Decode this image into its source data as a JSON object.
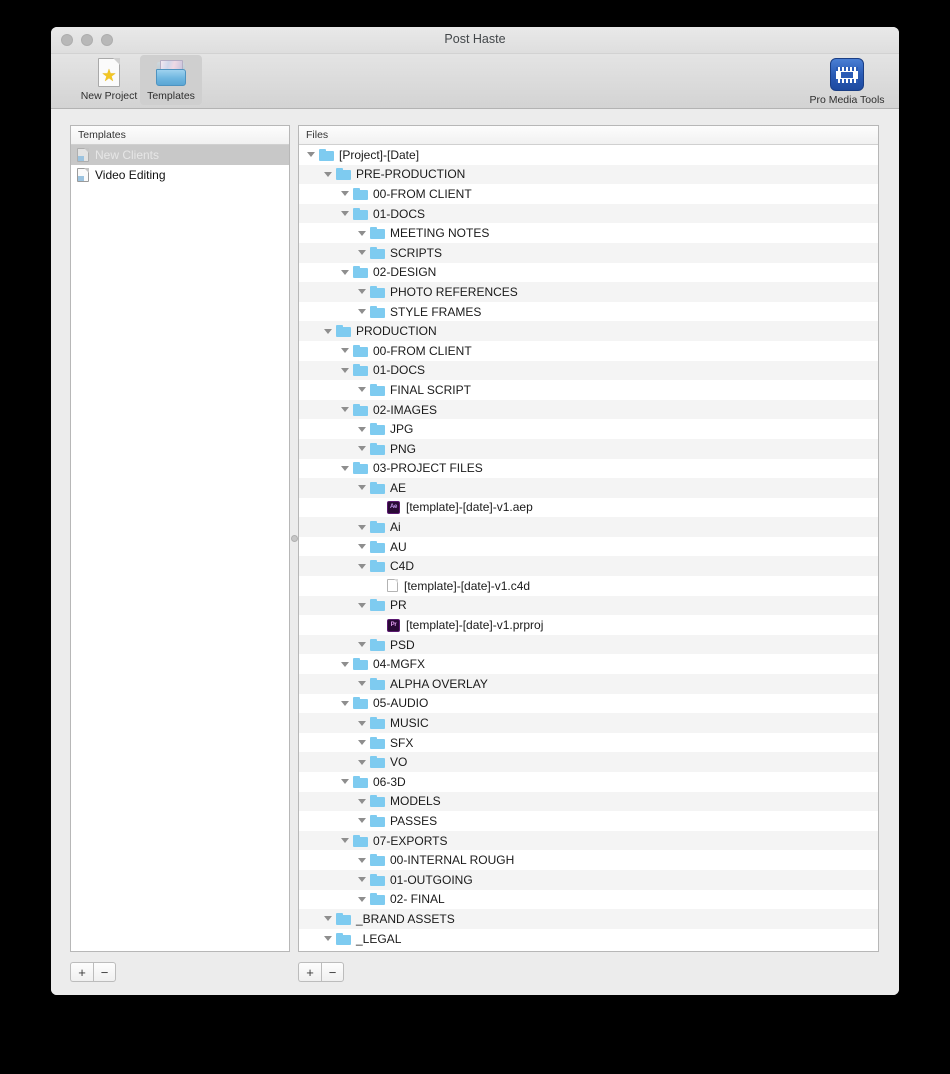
{
  "window": {
    "title": "Post Haste",
    "traffic_lights": [
      "close",
      "minimize",
      "zoom"
    ]
  },
  "toolbar": {
    "items": [
      {
        "label": "New Project",
        "icon": "star-document-icon",
        "selected": false
      },
      {
        "label": "Templates",
        "icon": "templates-folder-icon",
        "selected": true
      }
    ],
    "right_item": {
      "label": "Pro Media Tools",
      "icon": "film-strip-icon"
    }
  },
  "templates_panel": {
    "header": "Templates",
    "items": [
      {
        "label": "New Clients",
        "icon": "document-icon",
        "selected": true
      },
      {
        "label": "Video Editing",
        "icon": "document-icon",
        "selected": false
      }
    ],
    "add_label": "+",
    "remove_label": "−"
  },
  "files_panel": {
    "header": "Files",
    "add_label": "+",
    "remove_label": "−",
    "rows": [
      {
        "label": "[Project]-[Date]",
        "depth": 0,
        "type": "folder"
      },
      {
        "label": "PRE-PRODUCTION",
        "depth": 1,
        "type": "folder"
      },
      {
        "label": "00-FROM CLIENT",
        "depth": 2,
        "type": "folder"
      },
      {
        "label": "01-DOCS",
        "depth": 2,
        "type": "folder"
      },
      {
        "label": "MEETING NOTES",
        "depth": 3,
        "type": "folder"
      },
      {
        "label": "SCRIPTS",
        "depth": 3,
        "type": "folder"
      },
      {
        "label": "02-DESIGN",
        "depth": 2,
        "type": "folder"
      },
      {
        "label": "PHOTO REFERENCES",
        "depth": 3,
        "type": "folder"
      },
      {
        "label": "STYLE FRAMES",
        "depth": 3,
        "type": "folder"
      },
      {
        "label": "PRODUCTION",
        "depth": 1,
        "type": "folder"
      },
      {
        "label": "00-FROM CLIENT",
        "depth": 2,
        "type": "folder"
      },
      {
        "label": "01-DOCS",
        "depth": 2,
        "type": "folder"
      },
      {
        "label": "FINAL SCRIPT",
        "depth": 3,
        "type": "folder"
      },
      {
        "label": "02-IMAGES",
        "depth": 2,
        "type": "folder"
      },
      {
        "label": "JPG",
        "depth": 3,
        "type": "folder"
      },
      {
        "label": "PNG",
        "depth": 3,
        "type": "folder"
      },
      {
        "label": "03-PROJECT FILES",
        "depth": 2,
        "type": "folder"
      },
      {
        "label": "AE",
        "depth": 3,
        "type": "folder"
      },
      {
        "label": "[template]-[date]-v1.aep",
        "depth": 4,
        "type": "file-ae",
        "icon_text": "Ae"
      },
      {
        "label": "Ai",
        "depth": 3,
        "type": "folder"
      },
      {
        "label": "AU",
        "depth": 3,
        "type": "folder"
      },
      {
        "label": "C4D",
        "depth": 3,
        "type": "folder"
      },
      {
        "label": "[template]-[date]-v1.c4d",
        "depth": 4,
        "type": "file-plain"
      },
      {
        "label": "PR",
        "depth": 3,
        "type": "folder"
      },
      {
        "label": "[template]-[date]-v1.prproj",
        "depth": 4,
        "type": "file-pr",
        "icon_text": "Pr"
      },
      {
        "label": "PSD",
        "depth": 3,
        "type": "folder"
      },
      {
        "label": "04-MGFX",
        "depth": 2,
        "type": "folder"
      },
      {
        "label": "ALPHA OVERLAY",
        "depth": 3,
        "type": "folder"
      },
      {
        "label": "05-AUDIO",
        "depth": 2,
        "type": "folder"
      },
      {
        "label": "MUSIC",
        "depth": 3,
        "type": "folder"
      },
      {
        "label": "SFX",
        "depth": 3,
        "type": "folder"
      },
      {
        "label": "VO",
        "depth": 3,
        "type": "folder"
      },
      {
        "label": "06-3D",
        "depth": 2,
        "type": "folder"
      },
      {
        "label": "MODELS",
        "depth": 3,
        "type": "folder"
      },
      {
        "label": "PASSES",
        "depth": 3,
        "type": "folder"
      },
      {
        "label": "07-EXPORTS",
        "depth": 2,
        "type": "folder"
      },
      {
        "label": "00-INTERNAL ROUGH",
        "depth": 3,
        "type": "folder"
      },
      {
        "label": "01-OUTGOING",
        "depth": 3,
        "type": "folder"
      },
      {
        "label": "02- FINAL",
        "depth": 3,
        "type": "folder"
      },
      {
        "label": "_BRAND ASSETS",
        "depth": 1,
        "type": "folder"
      },
      {
        "label": "_LEGAL",
        "depth": 1,
        "type": "folder"
      }
    ]
  },
  "colors": {
    "folder_blue": "#7ecbf0",
    "accent_blue": "#2a5bb5",
    "adobe_purple": "#2a0a36",
    "selection_gray": "#c8c8c8",
    "row_alt": "#f4f4f4"
  }
}
